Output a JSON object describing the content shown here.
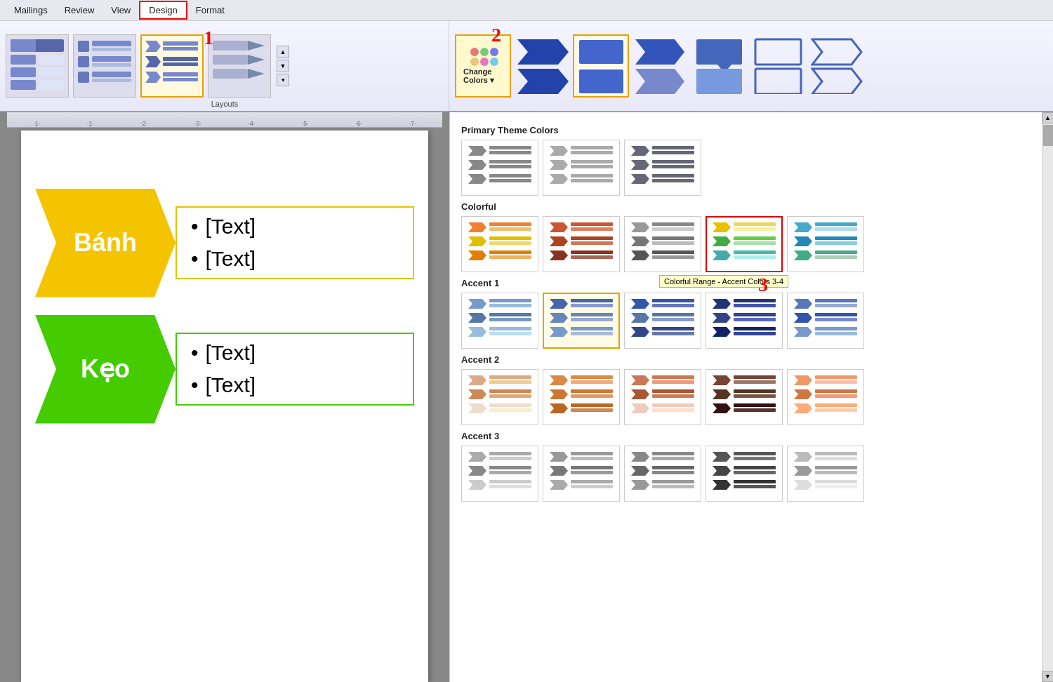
{
  "menu": {
    "items": [
      "Mailings",
      "Review",
      "View",
      "Design",
      "Format"
    ],
    "active": "Design",
    "highlighted": "Design"
  },
  "ribbon": {
    "layouts_label": "Layouts",
    "change_colors_label": "Change Colors ▾",
    "layouts": [
      {
        "id": "layout1",
        "selected": false
      },
      {
        "id": "layout2",
        "selected": false
      },
      {
        "id": "layout3",
        "selected": true
      },
      {
        "id": "layout4",
        "selected": false
      }
    ]
  },
  "document": {
    "rows": [
      {
        "label": "Bánh",
        "label_color": "yellow",
        "texts": [
          "[Text]",
          "[Text]"
        ]
      },
      {
        "label": "Kẹo",
        "label_color": "green",
        "texts": [
          "[Text]",
          "[Text]"
        ]
      }
    ]
  },
  "dropdown": {
    "sections": [
      {
        "id": "primary",
        "title": "Primary Theme Colors",
        "options": [
          {
            "id": "ptc1",
            "selected": false
          },
          {
            "id": "ptc2",
            "selected": false
          },
          {
            "id": "ptc3",
            "selected": false
          }
        ]
      },
      {
        "id": "colorful",
        "title": "Colorful",
        "options": [
          {
            "id": "cf1",
            "selected": false
          },
          {
            "id": "cf2",
            "selected": false
          },
          {
            "id": "cf3",
            "selected": false
          },
          {
            "id": "cf4",
            "selected": true,
            "tooltip": "Colorful Range - Accent Colors 3-4"
          },
          {
            "id": "cf5",
            "selected": false
          }
        ]
      },
      {
        "id": "accent1",
        "title": "Accent 1",
        "options": [
          {
            "id": "a11",
            "selected": false
          },
          {
            "id": "a12",
            "selected": true
          },
          {
            "id": "a13",
            "selected": false
          },
          {
            "id": "a14",
            "selected": false
          },
          {
            "id": "a15",
            "selected": false
          }
        ]
      },
      {
        "id": "accent2",
        "title": "Accent 2",
        "options": [
          {
            "id": "a21",
            "selected": false
          },
          {
            "id": "a22",
            "selected": false
          },
          {
            "id": "a23",
            "selected": false
          },
          {
            "id": "a24",
            "selected": false
          },
          {
            "id": "a25",
            "selected": false
          }
        ]
      },
      {
        "id": "accent3",
        "title": "Accent 3",
        "options": [
          {
            "id": "a31",
            "selected": false
          },
          {
            "id": "a32",
            "selected": false
          },
          {
            "id": "a33",
            "selected": false
          },
          {
            "id": "a34",
            "selected": false
          },
          {
            "id": "a35",
            "selected": false
          }
        ]
      }
    ]
  },
  "labels": {
    "num1": "1",
    "num2": "2",
    "num3": "3",
    "bullet": "•",
    "text_placeholder": "[Text]"
  }
}
